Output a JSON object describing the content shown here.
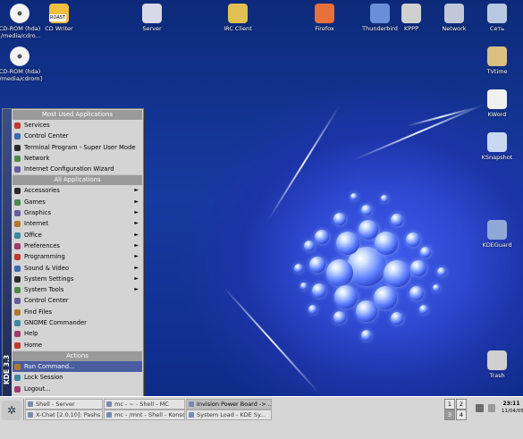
{
  "desktop_icons": [
    {
      "label": "CD-ROM (hda)",
      "sub": "[/media/cdro...",
      "icon": "cdrom-icon",
      "color": "#e8e8e8"
    },
    {
      "label": "CD Writer",
      "sub": "",
      "badge": "ROAST",
      "icon": "cd-writer-icon",
      "color": "#f0c040"
    },
    {
      "label": "Server",
      "sub": "",
      "icon": "server-icon",
      "color": "#d8d8e8"
    },
    {
      "label": "IRC Client",
      "sub": "",
      "icon": "irc-client-icon",
      "color": "#e0c050"
    },
    {
      "label": "Firefox",
      "sub": "",
      "icon": "firefox-icon",
      "color": "#e8703a"
    },
    {
      "label": "Thunderbird",
      "sub": "",
      "icon": "thunderbird-icon",
      "color": "#6a8fd8"
    },
    {
      "label": "KPPP",
      "sub": "",
      "icon": "kppp-icon",
      "color": "#d0d0d0"
    },
    {
      "label": "Network",
      "sub": "",
      "icon": "network-icon",
      "color": "#c0c8d8"
    },
    {
      "label": "Сеть",
      "sub": "",
      "icon": "network-icon",
      "color": "#b8c8e0"
    },
    {
      "label": "CD-ROM (hda)",
      "sub": "[/media/cdrom]",
      "icon": "cdrom-icon",
      "color": "#e8e8e8"
    },
    {
      "label": "TVtime",
      "sub": "",
      "icon": "tv-icon",
      "color": "#d8c080"
    },
    {
      "label": "KWord",
      "sub": "",
      "icon": "kword-icon",
      "color": "#f0f0f0"
    },
    {
      "label": "KSnapshot",
      "sub": "",
      "icon": "camera-icon",
      "color": "#c8d8f0"
    },
    {
      "label": "KDEGuard",
      "sub": "",
      "icon": "kdeguard-icon",
      "color": "#90a8d8"
    },
    {
      "label": "Trash",
      "sub": "",
      "icon": "trash-icon",
      "color": "#d0d0d0"
    }
  ],
  "menu": {
    "sidebar_label": "KDE 3.3",
    "sections": {
      "most_used": "Most Used Applications",
      "all": "All Applications",
      "actions": "Actions"
    },
    "most_used": [
      "Services",
      "Control Center",
      "Terminal Program - Super User Mode",
      "Network",
      "Internet Configuration Wizard"
    ],
    "all": [
      {
        "label": "Accessories",
        "sub": true
      },
      {
        "label": "Games",
        "sub": true
      },
      {
        "label": "Graphics",
        "sub": true
      },
      {
        "label": "Internet",
        "sub": true
      },
      {
        "label": "Office",
        "sub": true
      },
      {
        "label": "Preferences",
        "sub": true
      },
      {
        "label": "Programming",
        "sub": true
      },
      {
        "label": "Sound & Video",
        "sub": true
      },
      {
        "label": "System Settings",
        "sub": true
      },
      {
        "label": "System Tools",
        "sub": true
      },
      {
        "label": "Control Center",
        "sub": false
      },
      {
        "label": "Find Files",
        "sub": false
      },
      {
        "label": "GNOME Commander",
        "sub": false
      },
      {
        "label": "Help",
        "sub": false
      },
      {
        "label": "Home",
        "sub": false
      }
    ],
    "actions": [
      "Run Command...",
      "Lock Session",
      "Logout..."
    ],
    "selected": "Run Command..."
  },
  "taskbar": {
    "tasks_row1": [
      "Shell - Server",
      "mc - ~ - Shell - MC",
      "Invision Power Board -> ..."
    ],
    "tasks_row2": [
      "X-Chat [2.0.10]: Pashs @...",
      "mc - /mnt - Shell - Konsole",
      "System Load - KDE Sy..."
    ],
    "desktops": [
      "1",
      "2",
      "3",
      "4"
    ],
    "current_desktop": "3",
    "clock_time": "23:11",
    "clock_date": "11/04/05"
  }
}
